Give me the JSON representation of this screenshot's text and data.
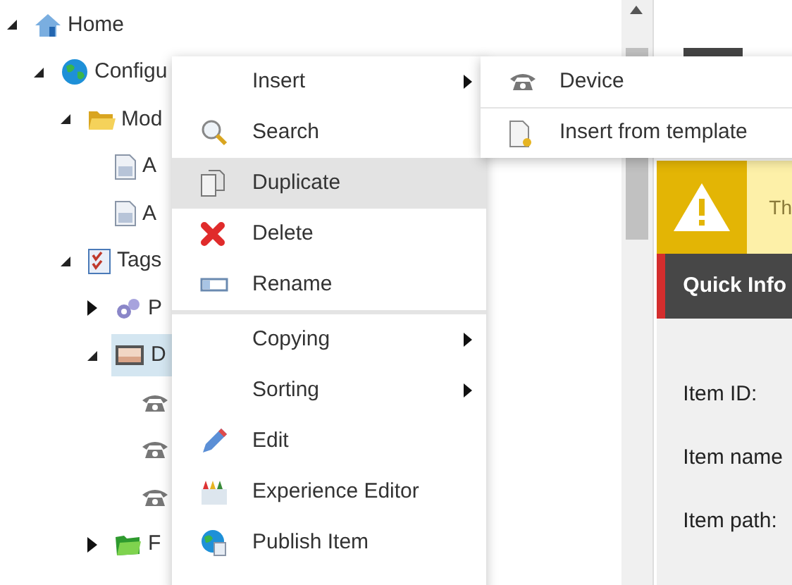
{
  "tree": [
    {
      "label": "Home",
      "expanded": true,
      "selected": false,
      "children": [
        {
          "label": "Configu",
          "expanded": true,
          "selected": false,
          "children": [
            {
              "label": "Mod",
              "expanded": true,
              "selected": false,
              "children": [
                {
                  "label": "A",
                  "selected": false
                },
                {
                  "label": "A",
                  "selected": false
                }
              ]
            },
            {
              "label": "Tags",
              "expanded": true,
              "selected": false,
              "children": [
                {
                  "label": "P",
                  "expanded": false,
                  "selected": false
                },
                {
                  "label": "D",
                  "expanded": true,
                  "selected": true,
                  "children": [
                    {
                      "selected": false
                    },
                    {
                      "selected": false
                    },
                    {
                      "selected": false
                    }
                  ]
                },
                {
                  "label": "F",
                  "expanded": false,
                  "selected": false
                }
              ]
            }
          ]
        }
      ]
    }
  ],
  "context_menu": [
    {
      "label": "Insert",
      "submenu": true,
      "selected": false
    },
    {
      "label": "Search",
      "submenu": false,
      "selected": false
    },
    {
      "label": "Duplicate",
      "submenu": false,
      "selected": true
    },
    {
      "label": "Delete",
      "submenu": false,
      "selected": false
    },
    {
      "label": "Rename",
      "submenu": false,
      "selected": false
    },
    {
      "label": "Copying",
      "submenu": true,
      "selected": false
    },
    {
      "label": "Sorting",
      "submenu": true,
      "selected": false
    },
    {
      "label": "Edit",
      "submenu": false,
      "selected": false
    },
    {
      "label": "Experience Editor",
      "submenu": false,
      "selected": false
    },
    {
      "label": "Publish Item",
      "submenu": false,
      "selected": false
    }
  ],
  "submenu": [
    {
      "label": "Device",
      "selected": false
    },
    {
      "label": "Insert from template",
      "selected": false
    }
  ],
  "warning": {
    "text": "Th"
  },
  "quick_info": {
    "title": "Quick Info",
    "fields": [
      "Item ID:",
      "Item name",
      "Item path:"
    ]
  }
}
